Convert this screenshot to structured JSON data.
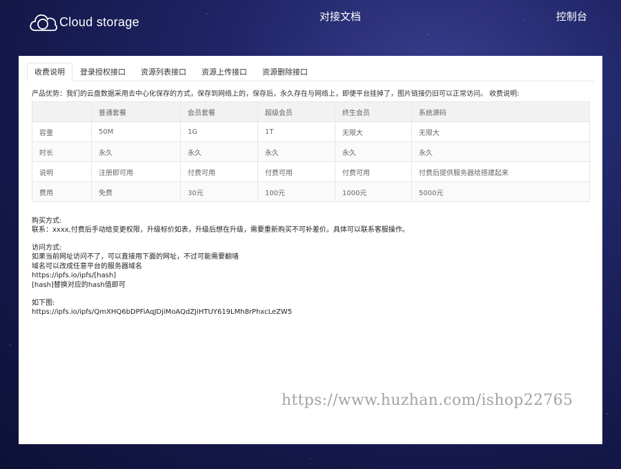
{
  "header": {
    "logo_text": "Cloud storage",
    "nav": {
      "docs": "对接文档",
      "console": "控制台"
    }
  },
  "tabs": [
    {
      "label": "收费说明",
      "active": true
    },
    {
      "label": "登录授权接口",
      "active": false
    },
    {
      "label": "资源列表接口",
      "active": false
    },
    {
      "label": "资源上传接口",
      "active": false
    },
    {
      "label": "资源删除接口",
      "active": false
    }
  ],
  "intro": "产品优势：我们的云盘数据采用去中心化保存的方式，保存到网络上的，保存后，永久存在与网络上，即便平台挂掉了，图片链接仍旧可以正常访问。 收费说明:",
  "pricing": {
    "headers": [
      "",
      "普通套餐",
      "会员套餐",
      "超级会员",
      "终生会员",
      "系统源码"
    ],
    "rows": [
      [
        "容量",
        "50M",
        "1G",
        "1T",
        "无限大",
        "无限大"
      ],
      [
        "时长",
        "永久",
        "永久",
        "永久",
        "永久",
        "永久"
      ],
      [
        "说明",
        "注册即可用",
        "付费可用",
        "付费可用",
        "付费可用",
        "付费后提供服务器给搭建起来"
      ],
      [
        "费用",
        "免费",
        "30元",
        "100元",
        "1000元",
        "5000元"
      ]
    ]
  },
  "purchase": {
    "title": "购买方式:",
    "line1": "联系：xxxx,付费后手动给变更权限，升级标价如表，升级后想在升级，需要重新购买不可补差价。具体可以联系客服操作。"
  },
  "access": {
    "title": "访问方式:",
    "line1": "如果当前网址访问不了，可以直接用下面的网址，不过可能需要翻墙",
    "line2": "域名可以改成任意平台的服务器域名",
    "line3": "https://ipfs.io/ipfs/[hash]",
    "line4": "[hash]替换对应的hash值即可"
  },
  "example": {
    "title": "如下图:",
    "url": "https://ipfs.io/ipfs/QmXHQ6bDPFiAqJDjiMoAQdZJiHTUY619LMh8rPhxcLeZW5"
  },
  "watermark": "https://www.huzhan.com/ishop22765"
}
